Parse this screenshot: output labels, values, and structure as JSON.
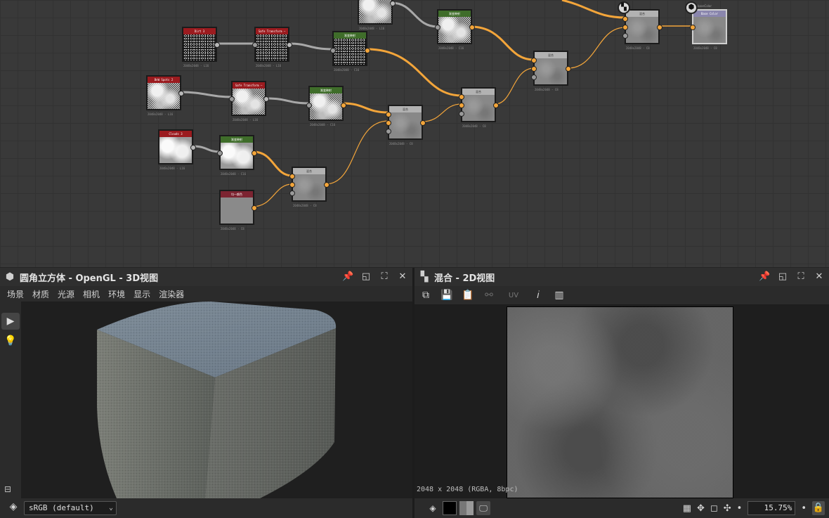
{
  "graph": {
    "nodes": [
      {
        "key": "n_top_clouds",
        "header": "",
        "meta": "2048x2048 - L16"
      },
      {
        "key": "n_top_green",
        "header": "渐变映射",
        "meta": "2048x2048 - C16"
      },
      {
        "key": "n_dirt",
        "header": "Dirt 3",
        "meta": "2048x2048 - L16"
      },
      {
        "key": "n_safe1",
        "header": "Safe Transform —",
        "meta": "2048x2048 - L16"
      },
      {
        "key": "n_green2",
        "header": "渐变映射",
        "meta": "2048x2048 - C16"
      },
      {
        "key": "n_blend_top",
        "header": "混合",
        "meta": "2048x2048 - C8"
      },
      {
        "key": "n_output",
        "header": "Base Color",
        "meta": "2048x2048 - C8"
      },
      {
        "key": "n_blend_mid",
        "header": "混合",
        "meta": "2048x2048 - C8"
      },
      {
        "key": "n_blend_b",
        "header": "混合",
        "meta": "2048x2048 - C8"
      },
      {
        "key": "n_bnw",
        "header": "BnW Spots 2",
        "meta": "2048x2048 - L16"
      },
      {
        "key": "n_safe2",
        "header": "Safe Transform —",
        "meta": "2048x2048 - L16"
      },
      {
        "key": "n_green3",
        "header": "渐变映射",
        "meta": "2048x2048 - C16"
      },
      {
        "key": "n_blend_c",
        "header": "混合",
        "meta": "2048x2048 - C8"
      },
      {
        "key": "n_clouds3",
        "header": "Clouds 3",
        "meta": "2048x2048 - L16"
      },
      {
        "key": "n_green4",
        "header": "渐变映射",
        "meta": "2048x2048 - C16"
      },
      {
        "key": "n_blend_d",
        "header": "混合",
        "meta": "2048x2048 - C8"
      },
      {
        "key": "n_uniform",
        "header": "均一颜色",
        "meta": "2048x2048 - C8"
      }
    ],
    "output_badge_label": "baseColor"
  },
  "panel3d": {
    "title": "圆角立方体 - OpenGL - 3D视图",
    "menu": [
      "场景",
      "材质",
      "光源",
      "相机",
      "环境",
      "显示",
      "渲染器"
    ],
    "colorspace": "sRGB (default)"
  },
  "panel2d": {
    "title": "混合 - 2D视图",
    "uv_label": "UV",
    "info": "2048 x 2048 (RGBA, 8bpc)",
    "zoom": "15.75%"
  },
  "icons": {
    "panel3d": "cube-icon",
    "panel2d": "checker-icon",
    "pin": "pin-icon",
    "restore": "restore-icon",
    "maximize": "maximize-icon",
    "close": "close-icon",
    "camera": "camera-icon",
    "light": "lightbulb-icon",
    "layers": "layers-icon",
    "lock": "lock-icon",
    "info": "info-icon",
    "histogram": "histogram-icon"
  },
  "colors": {
    "wire_active": "#f3a53a",
    "wire_idle": "#9a9a9a",
    "node_red": "#9b1b1f",
    "node_green": "#3f6d2a"
  }
}
